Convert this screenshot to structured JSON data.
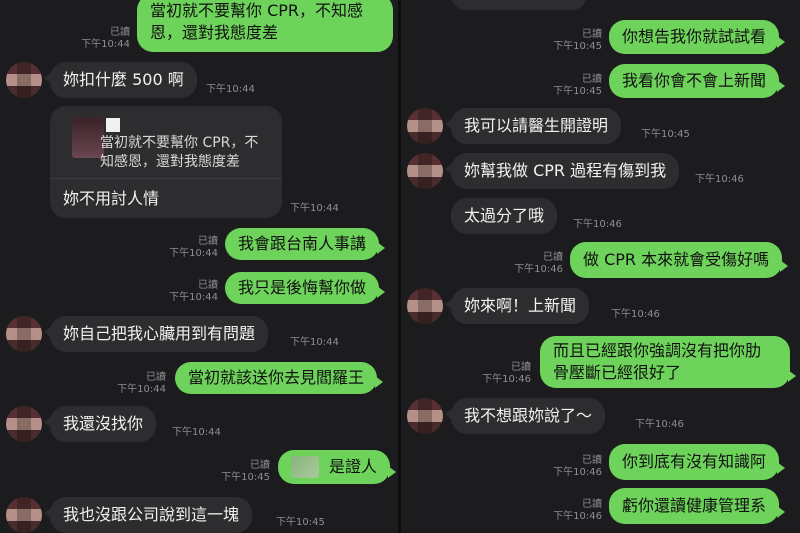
{
  "left": {
    "top_bubble": [
      "當初就不要幫你 CPR，不知感",
      "恩，還對我態度差"
    ],
    "top_meta": {
      "read": "已讀",
      "time": "下午10:44"
    },
    "msg1": {
      "text": "妳扣什麼 500 啊",
      "time": "下午10:44"
    },
    "quote": {
      "lines": [
        "當初就不要幫你 CPR，不",
        "知感恩，還對我態度差"
      ],
      "reply": "妳不用討人情",
      "time": "下午10:44"
    },
    "out2": {
      "text": "我會跟台南人事講",
      "read": "已讀",
      "time": "下午10:44"
    },
    "out3": {
      "text": "我只是後悔幫你做",
      "read": "已讀",
      "time": "下午10:44"
    },
    "msg4": {
      "text": "妳自己把我心臟用到有問題",
      "time": "下午10:44"
    },
    "out5": {
      "text": "當初就該送你去見閻羅王",
      "read": "已讀",
      "time": "下午10:44"
    },
    "msg6": {
      "text": "我還沒找你",
      "time": "下午10:44"
    },
    "out7": {
      "text": "是證人",
      "read": "已讀",
      "time": "下午10:45"
    },
    "msg8": {
      "text": "我也沒跟公司說到這一塊",
      "time": "下午10:45"
    }
  },
  "right": {
    "out1": {
      "text": "你想告我你就試試看",
      "read": "已讀",
      "time": "下午10:45"
    },
    "out2": {
      "text": "我看你會不會上新聞",
      "read": "已讀",
      "time": "下午10:45"
    },
    "msg3": {
      "text": "我可以請醫生開證明",
      "time": "下午10:45"
    },
    "msg4": {
      "text": "妳幫我做 CPR 過程有傷到我",
      "time": "下午10:46"
    },
    "msg5": {
      "text": "太過分了哦",
      "time": "下午10:46"
    },
    "out6": {
      "text": "做 CPR 本來就會受傷好嗎",
      "read": "已讀",
      "time": "下午10:46"
    },
    "msg7": {
      "text": "妳來啊！上新聞",
      "time": "下午10:46"
    },
    "out8": {
      "lines": [
        "而且已經跟你強調沒有把你肋",
        "骨壓斷已經很好了"
      ],
      "read": "已讀",
      "time": "下午10:46"
    },
    "msg9": {
      "text": "我不想跟妳說了～",
      "time": "下午10:46"
    },
    "out10": {
      "text": "你到底有沒有知識阿",
      "read": "已讀",
      "time": "下午10:46"
    },
    "out11": {
      "text": "虧你還讀健康管理系",
      "read": "已讀",
      "time": "下午10:46"
    }
  },
  "colors": {
    "background": "#1c1c1e",
    "incoming": "#2d2d30",
    "outgoing": "#6ed35b",
    "meta": "#8e8e93"
  }
}
